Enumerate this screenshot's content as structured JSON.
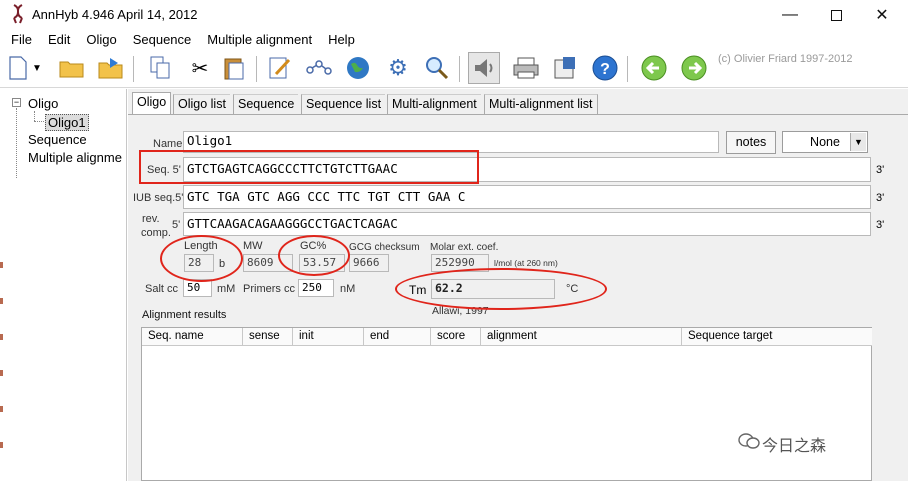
{
  "window": {
    "title": "AnnHyb 4.946   April 14, 2012",
    "app_icon": "dna-icon",
    "controls": [
      "minimize-icon",
      "maximize-icon",
      "close-icon"
    ]
  },
  "menu": [
    "File",
    "Edit",
    "Oligo",
    "Sequence",
    "Multiple alignment",
    "Help"
  ],
  "toolbar": {
    "copyright": "(c) Olivier Friard 1997-2012",
    "icons": [
      "new-document-icon",
      "dropdown-arrow-icon",
      "open-folder-icon",
      "open-recent-icon",
      "copy-icon",
      "cut-icon",
      "paste-icon",
      "edit-icon",
      "molecule-icon",
      "globe-icon",
      "settings-gear-icon",
      "search-icon",
      "speaker-icon",
      "print-icon",
      "tools-icon",
      "help-icon",
      "back-arrow-icon",
      "forward-arrow-icon"
    ]
  },
  "tree": {
    "root": "Oligo",
    "selected": "Oligo1",
    "items": [
      "Sequence",
      "Multiple alignme"
    ]
  },
  "tabs": [
    "Oligo",
    "Oligo list",
    "Sequence",
    "Sequence list",
    "Multi-alignment",
    "Multi-alignment list"
  ],
  "form": {
    "name_label": "Name",
    "name_value": "Oligo1",
    "notes_button": "notes",
    "none_select": "None",
    "seq_label": "Seq. 5'",
    "seq_value": "GTCTGAGTCAGGCCCTTCTGTCTTGAAC",
    "iub_label": "IUB seq.5'",
    "iub_value": "GTC TGA GTC AGG CCC TTC TGT CTT GAA C",
    "rev_label_line1": "rev.",
    "rev_label_line2": "comp.",
    "rev_prefix": "5'",
    "rev_value": "GTTCAAGACAGAAGGGCCTGACTCAGAC",
    "three_prime": "3'",
    "length_label": "Length",
    "length_value": "28",
    "length_unit": "b",
    "mw_label": "MW",
    "mw_value": "8609",
    "gc_label": "GC%",
    "gc_value": "53.57",
    "gcg_label": "GCG checksum",
    "gcg_value": "9666",
    "molar_label": "Molar ext. coef.",
    "molar_value": "252990",
    "molar_unit": "l/mol (at 260 nm)",
    "salt_label": "Salt cc",
    "salt_value": "50",
    "salt_unit": "mM",
    "primers_label": "Primers cc",
    "primers_value": "250",
    "primers_unit": "nM",
    "tm_label": "Tm",
    "tm_value": "62.2",
    "tm_unit": "°C",
    "tm_method": "Allawi, 1997"
  },
  "results": {
    "title": "Alignment results",
    "columns": [
      "Seq. name",
      "sense",
      "init",
      "end",
      "score",
      "alignment",
      "Sequence target"
    ]
  },
  "watermark": "今日之森",
  "annotation_color": "#e0251b"
}
